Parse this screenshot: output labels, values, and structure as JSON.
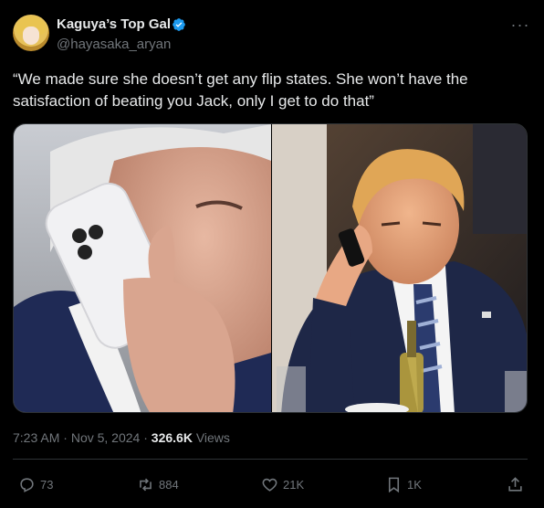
{
  "author": {
    "display_name": "Kaguya’s Top Gal",
    "handle": "@hayasaka_aryan",
    "verified": true
  },
  "tweet": {
    "text": "“We made sure she doesn’t get any flip states. She won’t have the satisfaction of beating you Jack, only I get to do that”"
  },
  "media": {
    "left_photo": "photo-man-on-phone-left",
    "right_photo": "photo-man-on-phone-right"
  },
  "meta": {
    "time": "7:23 AM",
    "dot1": " · ",
    "date": "Nov 5, 2024",
    "dot2": " · ",
    "views_count": "326.6K",
    "views_label": " Views"
  },
  "actions": {
    "replies": "73",
    "reposts": "884",
    "likes": "21K",
    "bookmarks": "1K"
  },
  "colors": {
    "background": "#000000",
    "text": "#e7e9ea",
    "muted": "#71767b",
    "verified": "#1d9bf0",
    "border": "#2f3336"
  }
}
